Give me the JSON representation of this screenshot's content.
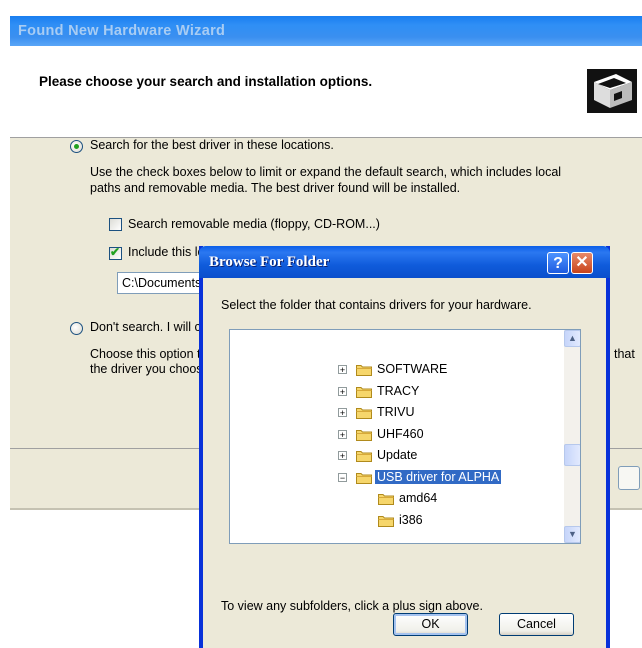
{
  "wizard": {
    "title": "Found New Hardware Wizard",
    "heading": "Please choose your search and installation options.",
    "options": {
      "search_label": "Search for the best driver in these locations.",
      "search_description_line1": "Use the check boxes below to limit or expand the default search, which includes local",
      "search_description_line2": "paths and removable media. The best driver found will be installed.",
      "removable_media_label": "Search removable media (floppy, CD-ROM...)",
      "include_location_label": "Include this location in the search:",
      "location_value": "C:\\Documents and Settings",
      "dont_search_label": "Don't search. I will choose the driver to install.",
      "dont_search_description_line1": "Choose this option to select the device driver from a list. Windows does not guarantee that",
      "dont_search_description_line2": "the driver you choose will be the best match for your hardware."
    }
  },
  "browse_dialog": {
    "title": "Browse For Folder",
    "help_glyph": "?",
    "close_glyph": "✕",
    "description": "Select the folder that contains drivers for your hardware.",
    "tree_items": [
      {
        "label": "SOFTWARE",
        "expander": "+"
      },
      {
        "label": "TRACY",
        "expander": "+"
      },
      {
        "label": "TRIVU",
        "expander": "+"
      },
      {
        "label": "UHF460",
        "expander": "+"
      },
      {
        "label": "Update",
        "expander": "+"
      },
      {
        "label": "USB driver for ALPHA",
        "expander": "−",
        "selected": true
      },
      {
        "label": "amd64",
        "expander": ""
      },
      {
        "label": "i386",
        "expander": ""
      }
    ],
    "hint": "To view any subfolders, click a plus sign above.",
    "ok_label": "OK",
    "cancel_label": "Cancel"
  },
  "colors": {
    "title_bar": "#0a5ee8",
    "selection": "#316ac5",
    "dialog_face": "#ece9d8"
  }
}
